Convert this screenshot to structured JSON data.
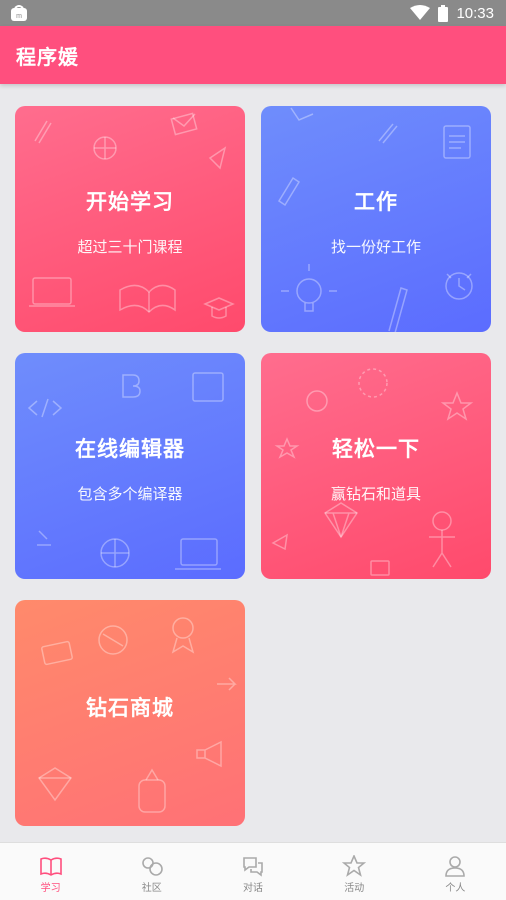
{
  "status_bar": {
    "time": "10:33",
    "icons": [
      "app-notification-icon",
      "wifi-icon",
      "battery-icon"
    ]
  },
  "app_bar": {
    "title": "程序媛"
  },
  "cards": [
    {
      "title": "开始学习",
      "subtitle": "超过三十门课程",
      "color": "#ff5677"
    },
    {
      "title": "工作",
      "subtitle": "找一份好工作",
      "color": "#6177fe"
    },
    {
      "title": "在线编辑器",
      "subtitle": "包含多个编译器",
      "color": "#6177fe"
    },
    {
      "title": "轻松一下",
      "subtitle": "赢钻石和道具",
      "color": "#ff5677"
    },
    {
      "title": "钻石商城",
      "subtitle": "",
      "color": "#ff7d72"
    }
  ],
  "bottom_nav": {
    "items": [
      {
        "label": "学习",
        "icon": "book-icon",
        "active": true
      },
      {
        "label": "社区",
        "icon": "community-icon",
        "active": false
      },
      {
        "label": "对话",
        "icon": "chat-icon",
        "active": false
      },
      {
        "label": "活动",
        "icon": "star-icon",
        "active": false
      },
      {
        "label": "个人",
        "icon": "person-icon",
        "active": false
      }
    ]
  },
  "colors": {
    "accent": "#ff4f7e",
    "status_bar": "#8a8a8a",
    "background": "#e9e9ec"
  }
}
